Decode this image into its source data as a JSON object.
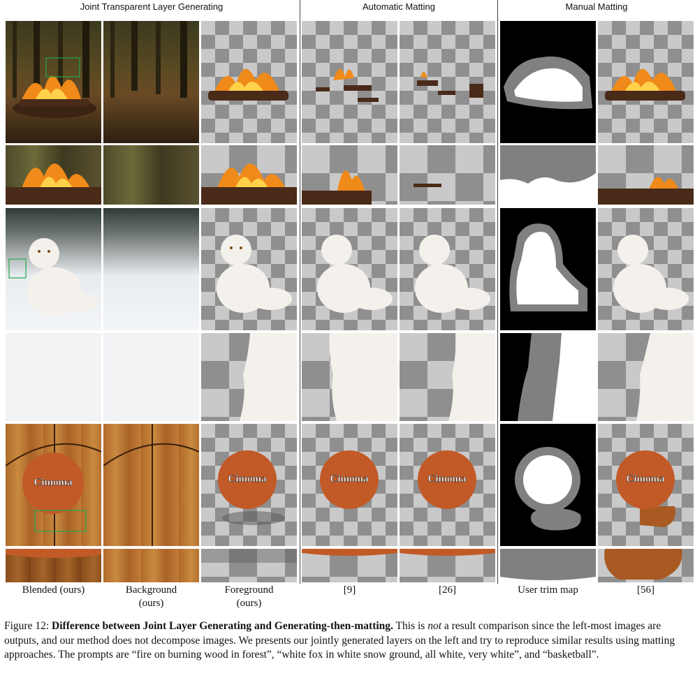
{
  "sections": {
    "joint": "Joint Transparent Layer Generating",
    "auto": "Automatic Matting",
    "manual": "Manual Matting"
  },
  "columns": [
    {
      "line1": "Blended (ours)",
      "line2": ""
    },
    {
      "line1": "Background",
      "line2": "(ours)"
    },
    {
      "line1": "Foreground",
      "line2": "(ours)"
    },
    {
      "line1": "[9]",
      "line2": ""
    },
    {
      "line1": "[26]",
      "line2": ""
    },
    {
      "line1": "User trim map",
      "line2": ""
    },
    {
      "line1": "[56]",
      "line2": ""
    }
  ],
  "basketball_brand": "Cimoma",
  "caption": {
    "label": "Figure 12:",
    "title": "Difference between Joint Layer Generating and Generating-then-matting.",
    "part1": "This is",
    "emph": "not",
    "part2": "a result comparison since the left-most images are outputs, and our method does not decompose images. We presents our jointly generated layers on the left and try to reproduce similar results using matting approaches. The prompts are “fire on burning wood in forest”, “white fox in white snow ground, all white, very white”, and “basketball”."
  },
  "colors": {
    "fire": "#f08a1a",
    "wood": "#4a2a18",
    "fox": "#f4f1ec",
    "ball": "#c25a28",
    "trimap_gray": "#808080",
    "highlight_box": "#1fa84a"
  }
}
